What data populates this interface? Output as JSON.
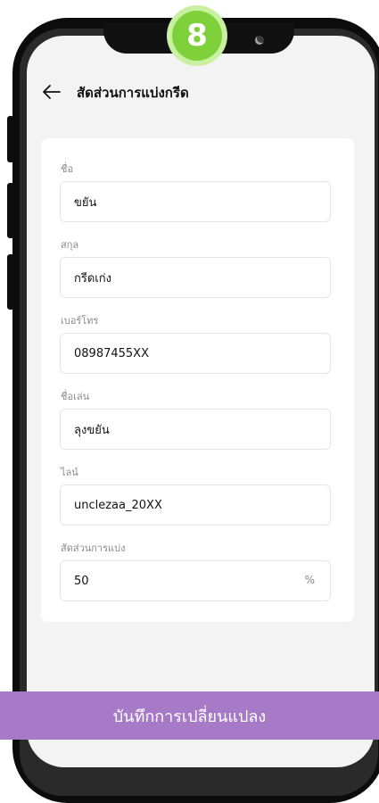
{
  "step_badge": "8",
  "header": {
    "title": "สัดส่วนการแบ่งกรีด"
  },
  "form": {
    "fields": [
      {
        "label": "ชื่อ",
        "value": "ขยัน"
      },
      {
        "label": "สกุล",
        "value": "กรีดเก่ง"
      },
      {
        "label": "เบอร์โทร",
        "value": "08987455XX"
      },
      {
        "label": "ชื่อเล่น",
        "value": "ลุงขยัน"
      },
      {
        "label": "ไลน์",
        "value": "unclezaa_20XX"
      },
      {
        "label": "สัดส่วนการแบ่ง",
        "value": "50",
        "suffix": "%"
      }
    ]
  },
  "save_button": {
    "label": "บันทึกการเปลี่ยนแปลง"
  },
  "colors": {
    "accent": "#a77ac7",
    "badge": "#7fd13b"
  }
}
